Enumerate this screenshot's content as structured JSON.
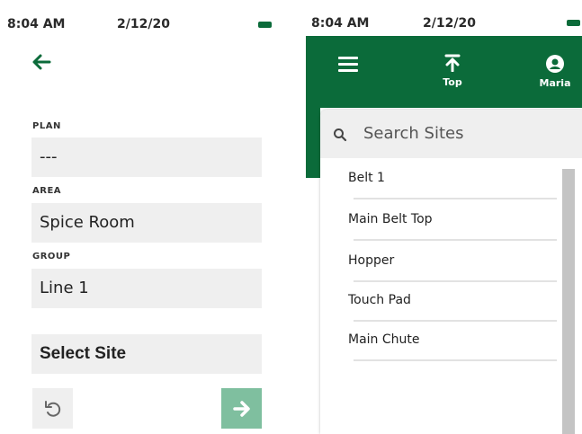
{
  "left_screen": {
    "status": {
      "time": "8:04 AM",
      "date": "2/12/20"
    },
    "fields": [
      {
        "label": "PLAN",
        "value": "---"
      },
      {
        "label": "AREA",
        "value": "Spice Room"
      },
      {
        "label": "GROUP",
        "value": "Line 1"
      }
    ],
    "select_site": {
      "label": "Select Site"
    }
  },
  "right_screen": {
    "status": {
      "time": "8:04 AM",
      "date": "2/12/20"
    },
    "toolbar": {
      "top_label": "Top",
      "user_label": "Maria"
    },
    "search": {
      "placeholder": "Search Sites"
    },
    "sites": [
      "Belt 1",
      "Main Belt Top",
      "Hopper",
      "Touch Pad",
      "Main Chute"
    ]
  },
  "colors": {
    "brand_green": "#0b6b3a",
    "next_button": "#7fbf9f",
    "field_bg": "#efefef"
  },
  "icons": {
    "back": "arrow-left-icon",
    "undo": "undo-icon",
    "next": "arrow-right-icon",
    "menu": "hamburger-icon",
    "top": "arrow-up-to-line-icon",
    "user": "user-circle-icon",
    "search": "search-icon",
    "battery": "battery-icon"
  }
}
